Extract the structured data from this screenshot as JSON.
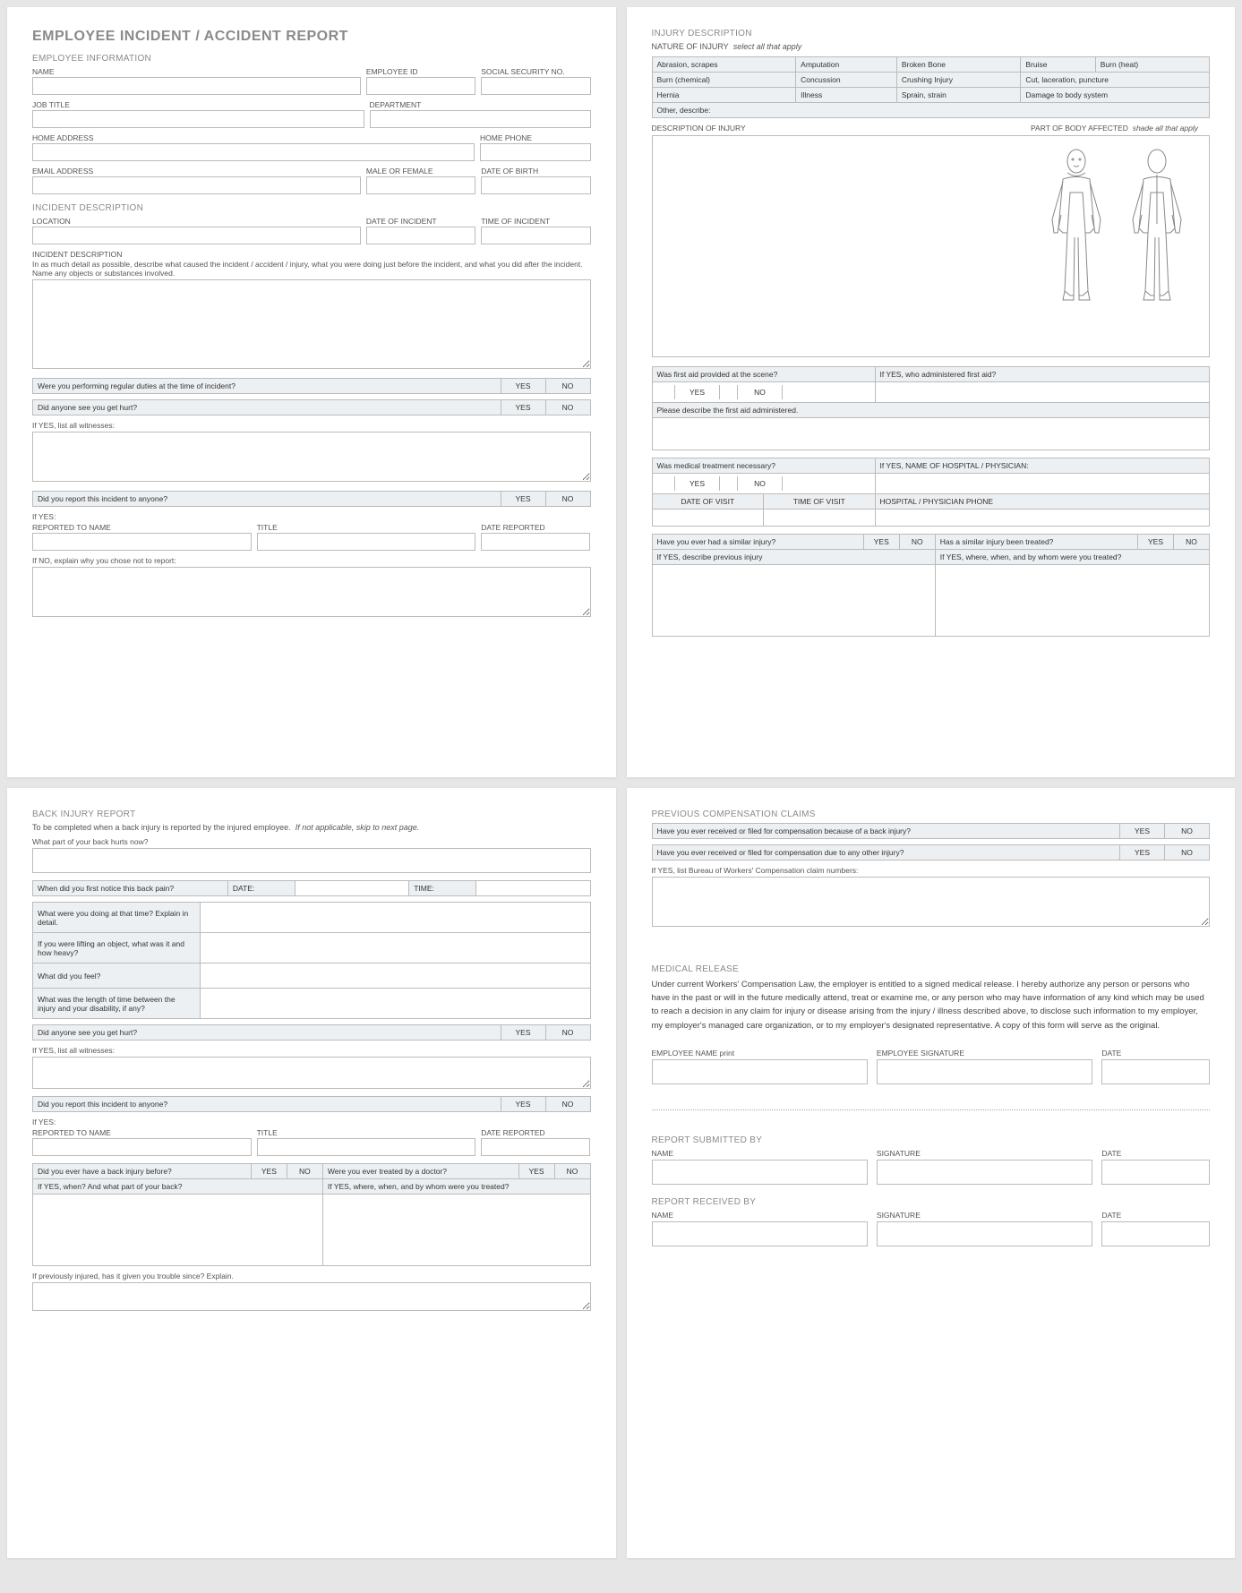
{
  "title": "EMPLOYEE INCIDENT / ACCIDENT REPORT",
  "sections": {
    "emp_info": "EMPLOYEE INFORMATION",
    "incident_desc": "INCIDENT DESCRIPTION",
    "back_injury": "BACK INJURY REPORT",
    "injury_desc": "INJURY DESCRIPTION",
    "prev_comp": "PREVIOUS COMPENSATION CLAIMS",
    "med_release": "MEDICAL RELEASE",
    "rep_sub": "REPORT SUBMITTED BY",
    "rep_rec": "REPORT RECEIVED BY"
  },
  "labels": {
    "name": "NAME",
    "emp_id": "EMPLOYEE ID",
    "ssn": "SOCIAL SECURITY NO.",
    "job_title": "JOB TITLE",
    "dept": "DEPARTMENT",
    "home_addr": "HOME ADDRESS",
    "home_phone": "HOME PHONE",
    "email": "EMAIL ADDRESS",
    "gender": "MALE OR FEMALE",
    "dob": "DATE OF BIRTH",
    "location": "LOCATION",
    "date_incident": "DATE OF INCIDENT",
    "time_incident": "TIME OF INCIDENT",
    "inc_desc_lbl": "INCIDENT DESCRIPTION",
    "inc_desc_hint": "In as much detail as possible, describe what caused the incident / accident / injury, what you were doing just before the incident, and what you did after the incident.  Name any objects or substances involved.",
    "regular_duties": "Were you performing regular duties at the time of incident?",
    "anyone_see": "Did anyone see you get hurt?",
    "list_witnesses": "If YES, list all witnesses:",
    "did_report": "Did you report this incident to anyone?",
    "if_yes": "If YES:",
    "reported_to": "REPORTED TO NAME",
    "title": "TITLE",
    "date_reported": "DATE REPORTED",
    "if_no_explain": "If NO, explain why you chose not to report:",
    "back_sub": "To be completed when a back injury is reported by the injured employee.",
    "back_sub_i": "If not applicable, skip to next page.",
    "back_hurt": "What part of your back hurts now?",
    "first_notice": "When did you first notice this back pain?",
    "date": "DATE:",
    "time": "TIME:",
    "doing_at_time": "What were you doing at that time?  Explain in detail.",
    "lifting": "If you were lifting an object, what was it and how heavy?",
    "feel": "What did you feel?",
    "length_time": "What was the length of time between the injury and your disability, if any?",
    "back_before": "Did you ever have a back injury before?",
    "treated_doctor": "Were you ever treated by a doctor?",
    "if_yes_when": "If YES, when? And what part of your back?",
    "if_yes_where": "If YES, where, when, and by whom were you treated?",
    "prev_trouble": "If previously injured, has it given you trouble since?  Explain.",
    "nature_lbl": "NATURE OF INJURY",
    "nature_i": "select all that apply",
    "desc_injury": "DESCRIPTION OF INJURY",
    "body_affected": "PART OF BODY AFFECTED",
    "body_i": "shade all that apply",
    "first_aid": "Was first aid provided at the scene?",
    "who_first_aid": "If YES, who administered first aid?",
    "describe_first_aid": "Please describe the first aid administered.",
    "med_necessary": "Was medical treatment necessary?",
    "hosp_name": "If YES, NAME OF HOSPITAL / PHYSICIAN:",
    "date_visit": "DATE OF VISIT",
    "time_visit": "TIME OF VISIT",
    "hosp_phone": "HOSPITAL / PHYSICIAN PHONE",
    "similar_injury": "Have you ever had a similar injury?",
    "similar_treated": "Has a similar injury been treated?",
    "desc_prev": "If YES, describe previous injury",
    "where_treated": "If YES, where, when, and by whom were you treated?",
    "comp_back": "Have you ever received or filed for compensation because of a back injury?",
    "comp_other": "Have you ever received or filed for compensation due to any other injury?",
    "list_claims": "If YES, list Bureau of Workers' Compensation claim numbers:",
    "release_text": "Under current Workers' Compensation Law, the employer is entitled to a signed medical release.  I hereby authorize any person or persons who have in the past or will in the future medically attend, treat or examine me, or any person who may have information of any kind which may be used to reach a decision in any claim for injury or disease arising from the injury / illness described above, to disclose such information to my employer, my employer's managed care organization, or to my employer's designated representative.  A copy of this form will serve as the original.",
    "emp_name_print": "EMPLOYEE NAME  print",
    "emp_sig": "EMPLOYEE SIGNATURE",
    "sig": "SIGNATURE",
    "date_s": "DATE",
    "yes": "YES",
    "no": "NO"
  },
  "injuries": [
    [
      "Abrasion, scrapes",
      "Amputation",
      "Broken Bone",
      "Bruise",
      "Burn (heat)"
    ],
    [
      "Burn (chemical)",
      "Concussion",
      "Crushing Injury",
      "Cut, laceration, puncture",
      ""
    ],
    [
      "Hernia",
      "Illness",
      "Sprain, strain",
      "Damage to body system",
      ""
    ],
    [
      "Other, describe:",
      "",
      "",
      "",
      ""
    ]
  ]
}
